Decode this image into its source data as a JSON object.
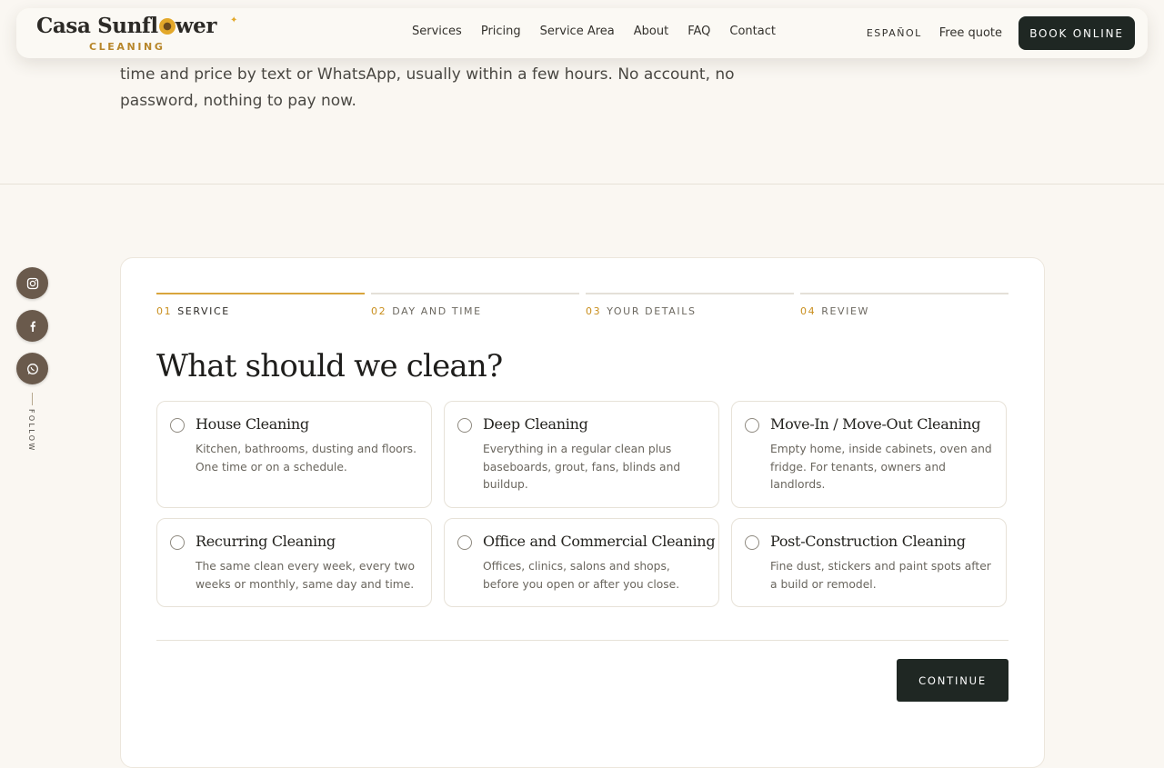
{
  "hero": {
    "heading_remnant": "",
    "intro_text": "time and price by text or WhatsApp, usually within a few hours. No account, no password, nothing to pay now."
  },
  "brand": {
    "name_part1": "Casa Sunfl",
    "name_part2": "wer",
    "sub": "CLEANING"
  },
  "nav": {
    "links": [
      "Services",
      "Pricing",
      "Service Area",
      "About",
      "FAQ",
      "Contact"
    ],
    "language": "ESPAÑOL",
    "free_quote": "Free quote",
    "book_online": "BOOK ONLINE"
  },
  "social": {
    "icons": [
      "instagram-icon",
      "facebook-icon",
      "whatsapp-icon"
    ],
    "follow_label": "FOLLOW"
  },
  "booking": {
    "steps": [
      {
        "num": "01",
        "label": "SERVICE",
        "active": true
      },
      {
        "num": "02",
        "label": "DAY AND TIME",
        "active": false
      },
      {
        "num": "03",
        "label": "YOUR DETAILS",
        "active": false
      },
      {
        "num": "04",
        "label": "REVIEW",
        "active": false
      }
    ],
    "title": "What should we clean?",
    "options": [
      {
        "title": "House Cleaning",
        "desc": "Kitchen, bathrooms, dusting and floors. One time or on a schedule."
      },
      {
        "title": "Deep Cleaning",
        "desc": "Everything in a regular clean plus baseboards, grout, fans, blinds and buildup."
      },
      {
        "title": "Move-In / Move-Out Cleaning",
        "desc": "Empty home, inside cabinets, oven and fridge. For tenants, owners and landlords."
      },
      {
        "title": "Recurring Cleaning",
        "desc": "The same clean every week, every two weeks or monthly, same day and time."
      },
      {
        "title": "Office and Commercial Cleaning",
        "desc": "Offices, clinics, salons and shops, before you open or after you close."
      },
      {
        "title": "Post-Construction Cleaning",
        "desc": "Fine dust, stickers and paint spots after a build or remodel."
      }
    ],
    "continue_label": "CONTINUE"
  },
  "colors": {
    "accent": "#d9a53d",
    "dark": "#1f2723",
    "background": "#faf7f2"
  }
}
